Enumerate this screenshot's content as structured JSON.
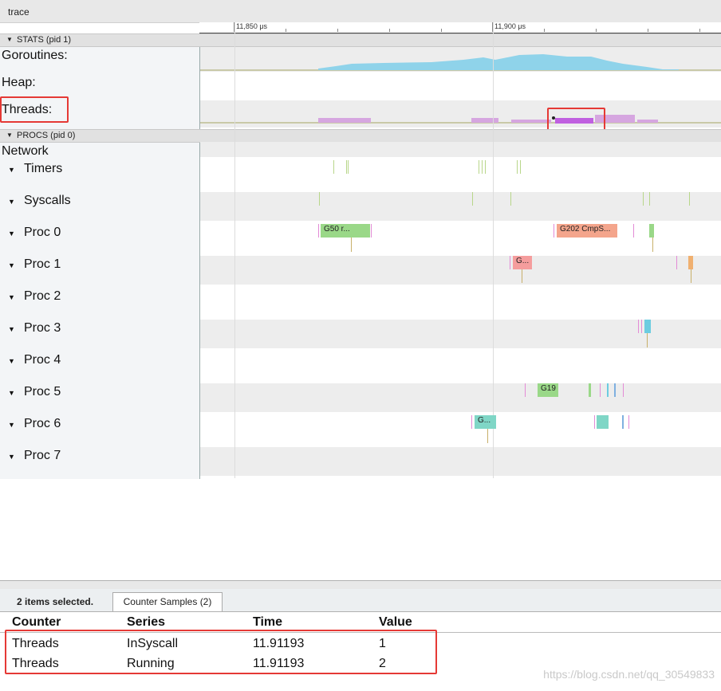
{
  "window": {
    "title": "trace"
  },
  "ruler": {
    "ticks": [
      {
        "label": "11,850 μs"
      },
      {
        "label": "11,900 μs"
      }
    ]
  },
  "stats": {
    "header": "STATS (pid 1)",
    "counters": [
      {
        "label": "Goroutines:"
      },
      {
        "label": "Heap:"
      },
      {
        "label": "Threads:"
      }
    ]
  },
  "procs": {
    "header": "PROCS (pid 0)",
    "rows": [
      {
        "label": "Network",
        "expandable": false
      },
      {
        "label": "Timers",
        "expandable": true
      },
      {
        "label": "Syscalls",
        "expandable": true
      },
      {
        "label": "Proc 0",
        "expandable": true
      },
      {
        "label": "Proc 1",
        "expandable": true
      },
      {
        "label": "Proc 2",
        "expandable": true
      },
      {
        "label": "Proc 3",
        "expandable": true
      },
      {
        "label": "Proc 4",
        "expandable": true
      },
      {
        "label": "Proc 5",
        "expandable": true
      },
      {
        "label": "Proc 6",
        "expandable": true
      },
      {
        "label": "Proc 7",
        "expandable": true
      }
    ],
    "slices": [
      {
        "row": "Proc 0",
        "label": "G50 r...",
        "color": "#9ad888"
      },
      {
        "row": "Proc 0",
        "label": "G202 CmpS...",
        "color": "#f4a58c"
      },
      {
        "row": "Proc 1",
        "label": "G...",
        "color": "#f59d9d"
      },
      {
        "row": "Proc 5",
        "label": "G19",
        "color": "#9ad888"
      },
      {
        "row": "Proc 6",
        "label": "G...",
        "color": "#7fd6c6"
      }
    ]
  },
  "colors": {
    "goroutines_area": "#8fd3ea",
    "threads_area": "#d6a6e0",
    "threads_selected": "#c060e0",
    "highlight_box": "#e53935"
  },
  "selection": {
    "summary": "2 items selected.",
    "tab_label": "Counter Samples (2)",
    "columns": [
      "Counter",
      "Series",
      "Time",
      "Value"
    ],
    "rows": [
      [
        "Threads",
        "InSyscall",
        "11.91193",
        "1"
      ],
      [
        "Threads",
        "Running",
        "11.91193",
        "2"
      ]
    ]
  },
  "watermark": "https://blog.csdn.net/qq_30549833"
}
